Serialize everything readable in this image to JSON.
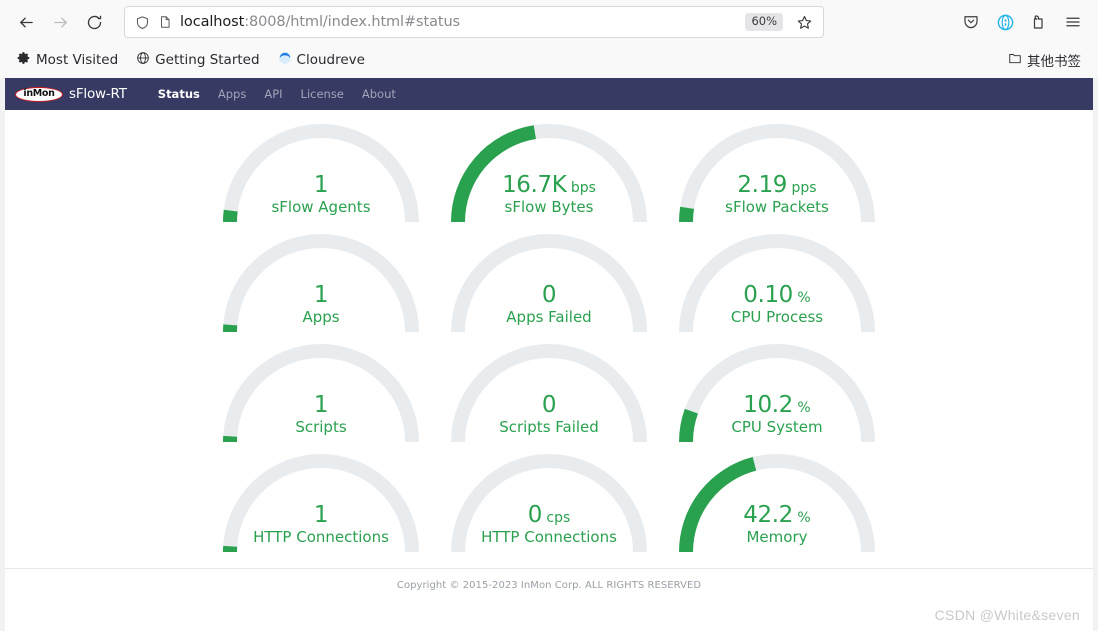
{
  "browser": {
    "nav": {
      "back_icon": "arrow-left-icon",
      "forward_icon": "arrow-right-icon",
      "reload_icon": "reload-icon"
    },
    "address_bar": {
      "shield_icon": "shield-icon",
      "page_icon": "page-icon",
      "url_host": "localhost",
      "url_rest": ":8008/html/index.html#status",
      "url_full": "localhost:8008/html/index.html#status",
      "zoom_level": "60%",
      "bookmark_icon": "star-icon"
    },
    "toolbar_right": [
      {
        "name": "pocket-icon",
        "label": "Pocket"
      },
      {
        "name": "extension-icon",
        "label": "Extension"
      },
      {
        "name": "save-to-icon",
        "label": "Save Page"
      },
      {
        "name": "hamburger-menu-icon",
        "label": "Open menu"
      }
    ],
    "bookmarks": [
      {
        "icon": "gear-icon",
        "label": "Most Visited"
      },
      {
        "icon": "globe-icon",
        "label": "Getting Started"
      },
      {
        "icon": "cloudreve-icon",
        "label": "Cloudreve"
      }
    ],
    "other_bookmarks": {
      "icon": "folder-icon",
      "label": "其他书签"
    }
  },
  "app": {
    "logo_text": "inMon",
    "brand": "sFlow-RT",
    "nav_items": [
      {
        "label": "Status",
        "active": true
      },
      {
        "label": "Apps",
        "active": false
      },
      {
        "label": "API",
        "active": false
      },
      {
        "label": "License",
        "active": false
      },
      {
        "label": "About",
        "active": false
      }
    ],
    "accent_green": "#2aa14f",
    "track_gray": "#e9ecef",
    "navbar_bg": "#373a62",
    "footer": "Copyright © 2015-2023 InMon Corp. ALL RIGHTS RESERVED"
  },
  "chart_data": {
    "type": "gauge",
    "title": "sFlow-RT Status",
    "units_note": "semicircular gauges, fraction 0..1 of half circle",
    "gauges": [
      {
        "title": "sFlow Agents",
        "value": "1",
        "unit": "",
        "fraction": 0.04
      },
      {
        "title": "sFlow Bytes",
        "value": "16.7K",
        "unit": "bps",
        "fraction": 0.45
      },
      {
        "title": "sFlow Packets",
        "value": "2.19",
        "unit": "pps",
        "fraction": 0.05
      },
      {
        "title": "Apps",
        "value": "1",
        "unit": "",
        "fraction": 0.025
      },
      {
        "title": "Apps Failed",
        "value": "0",
        "unit": "",
        "fraction": 0.0
      },
      {
        "title": "CPU Process",
        "value": "0.10",
        "unit": "%",
        "fraction": 0.0
      },
      {
        "title": "Scripts",
        "value": "1",
        "unit": "",
        "fraction": 0.02
      },
      {
        "title": "Scripts Failed",
        "value": "0",
        "unit": "",
        "fraction": 0.0
      },
      {
        "title": "CPU System",
        "value": "10.2",
        "unit": "%",
        "fraction": 0.11
      },
      {
        "title": "HTTP Connections",
        "value": "1",
        "unit": "",
        "fraction": 0.02
      },
      {
        "title": "HTTP Connections",
        "value": "0",
        "unit": "cps",
        "fraction": 0.0
      },
      {
        "title": "Memory",
        "value": "42.2",
        "unit": "%",
        "fraction": 0.42
      }
    ]
  },
  "watermark": "CSDN @White&seven"
}
